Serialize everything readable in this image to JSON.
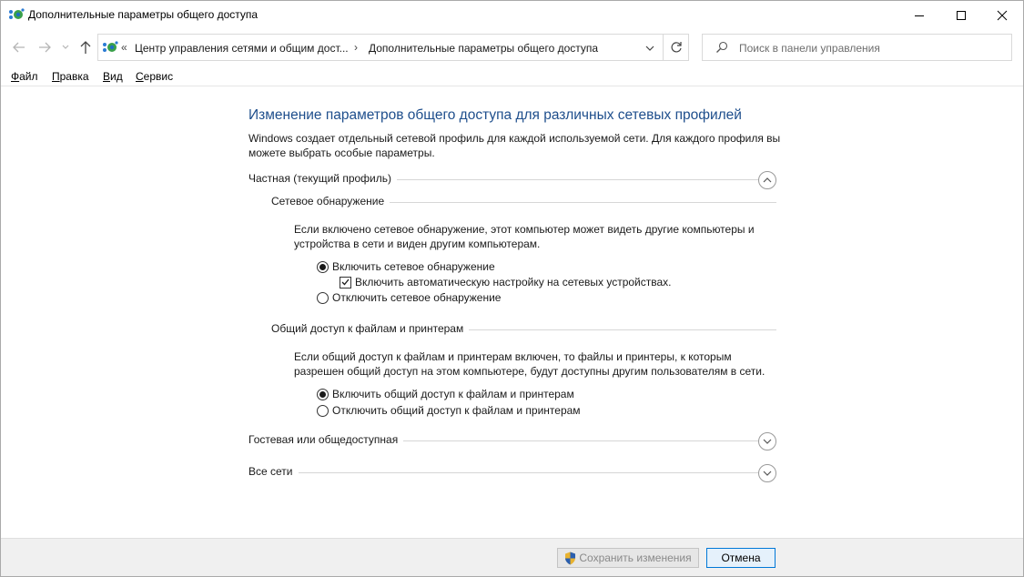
{
  "window": {
    "title": "Дополнительные параметры общего доступа",
    "minimize_icon": "minimize-icon",
    "maximize_icon": "maximize-icon",
    "close_icon": "close-icon"
  },
  "address_bar": {
    "overflow": "«",
    "segments": [
      "Центр управления сетями и общим дост...",
      "Дополнительные параметры общего доступа"
    ],
    "separator": "›"
  },
  "search": {
    "placeholder": "Поиск в панели управления"
  },
  "menu": {
    "items": [
      {
        "label": "Файл",
        "accel": "Ф",
        "rest": "айл"
      },
      {
        "label": "Правка",
        "accel": "П",
        "rest": "равка"
      },
      {
        "label": "Вид",
        "accel": "В",
        "rest": "ид"
      },
      {
        "label": "Сервис",
        "accel": "С",
        "rest": "ервис"
      }
    ]
  },
  "main": {
    "heading": "Изменение параметров общего доступа для различных сетевых профилей",
    "description": "Windows создает отдельный сетевой профиль для каждой используемой сети. Для каждого профиля вы можете выбрать особые параметры.",
    "profiles": {
      "private": {
        "title": "Частная (текущий профиль)",
        "expanded": true,
        "network_discovery": {
          "title": "Сетевое обнаружение",
          "text": "Если включено сетевое обнаружение, этот компьютер может видеть другие компьютеры и устройства в сети и виден другим компьютерам.",
          "option_on": "Включить сетевое обнаружение",
          "auto_setup": "Включить автоматическую настройку на сетевых устройствах.",
          "auto_setup_checked": true,
          "option_off": "Отключить сетевое обнаружение",
          "selected": "on"
        },
        "file_sharing": {
          "title": "Общий доступ к файлам и принтерам",
          "text": "Если общий доступ к файлам и принтерам включен, то файлы и принтеры, к которым разрешен общий доступ на этом компьютере, будут доступны другим пользователям в сети.",
          "option_on": "Включить общий доступ к файлам и принтерам",
          "option_off": "Отключить общий доступ к файлам и принтерам",
          "selected": "on"
        }
      },
      "guest": {
        "title": "Гостевая или общедоступная",
        "expanded": false
      },
      "all": {
        "title": "Все сети",
        "expanded": false
      }
    }
  },
  "footer": {
    "save_label": "Сохранить изменения",
    "save_enabled": false,
    "cancel_label": "Отмена"
  },
  "colors": {
    "heading": "#1e4e8c",
    "accent": "#0078d7"
  }
}
